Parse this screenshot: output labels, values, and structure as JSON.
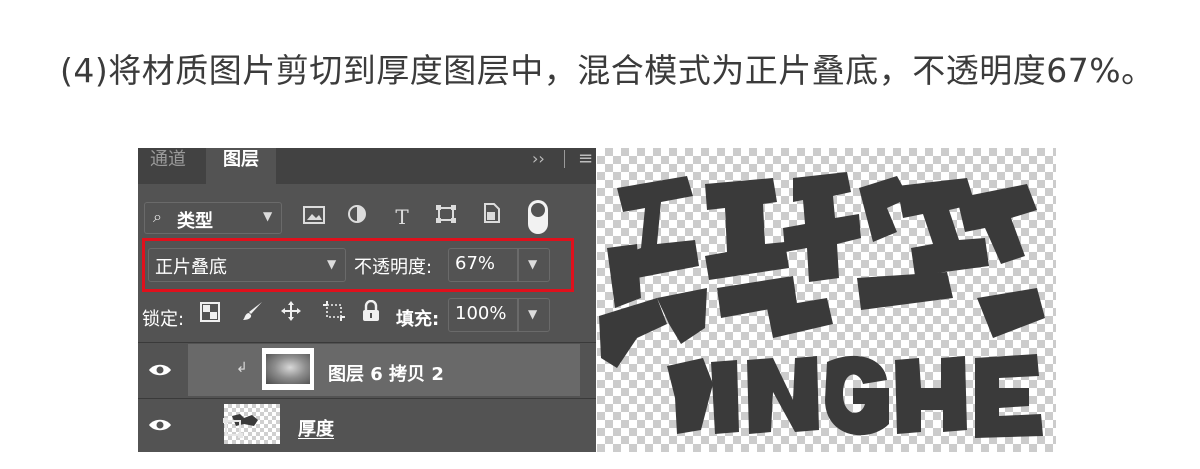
{
  "caption": "(4)将材质图片剪切到厚度图层中，混合模式为正片叠底，不透明度67%。",
  "panel": {
    "tabs": [
      {
        "label": "通道",
        "active": false
      },
      {
        "label": "图层",
        "active": true
      }
    ],
    "tab_controls": {
      "collapse": "››",
      "menu": "≡"
    },
    "filter": {
      "kind_label": "类型"
    },
    "filter_icons": [
      "image-filter-icon",
      "adjustment-filter-icon",
      "type-filter-icon",
      "shape-filter-icon",
      "smart-object-filter-icon"
    ],
    "blend_mode": "正片叠底",
    "opacity_label": "不透明度:",
    "opacity_value": "67%",
    "lock_label": "锁定:",
    "lock_icons": [
      "lock-transparent-pixels-icon",
      "lock-image-pixels-icon",
      "lock-position-icon",
      "lock-artboard-icon",
      "lock-all-icon"
    ],
    "fill_label": "填充:",
    "fill_value": "100%",
    "layers": [
      {
        "name": "图层 6 拷贝 2",
        "visible": true,
        "clipped": true,
        "selected": true
      },
      {
        "name": "厚度",
        "visible": true,
        "clipped": false,
        "selected": false
      }
    ]
  },
  "canvas": {
    "artwork_text": "YINGHE"
  },
  "colors": {
    "panel_bg": "#535353",
    "tabbar_bg": "#424242",
    "selected_row": "#696969",
    "highlight": "#e0101c",
    "caption_text": "#3b3b3b",
    "artwork_fill": "#3a3a3a"
  }
}
